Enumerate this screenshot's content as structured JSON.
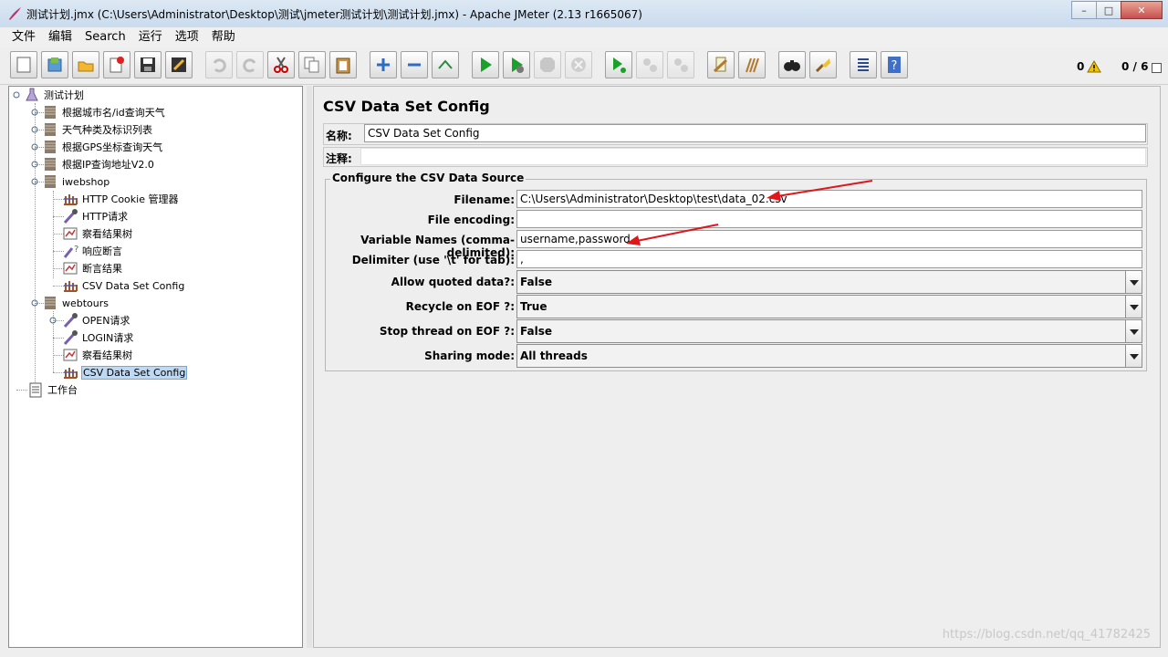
{
  "window": {
    "title": "测试计划.jmx (C:\\Users\\Administrator\\Desktop\\测试\\jmeter测试计划\\测试计划.jmx) - Apache JMeter (2.13 r1665067)",
    "minimize": "–",
    "maximize": "□",
    "close": "✕"
  },
  "menu": [
    "文件",
    "编辑",
    "Search",
    "运行",
    "选项",
    "帮助"
  ],
  "toolbar": {
    "error_count": "0",
    "thread_count": "0 / 6"
  },
  "tree": {
    "root": "测试计划",
    "items": [
      "根据城市名/id查询天气",
      "天气种类及标识列表",
      "根据GPS坐标查询天气",
      "根据IP查询地址V2.0",
      "iwebshop",
      "HTTP Cookie 管理器",
      "HTTP请求",
      "察看结果树",
      "响应断言",
      "断言结果",
      "CSV Data Set Config",
      "webtours",
      "OPEN请求",
      "LOGIN请求",
      "察看结果树",
      "CSV Data Set Config",
      "工作台"
    ]
  },
  "panel": {
    "title": "CSV Data Set Config",
    "name_label": "名称:",
    "name_value": "CSV Data Set Config",
    "comment_label": "注释:",
    "comment_value": "",
    "group_title": "Configure the CSV Data Source",
    "fields": {
      "filename_label": "Filename:",
      "filename_value": "C:\\Users\\Administrator\\Desktop\\test\\data_02.csv",
      "encoding_label": "File encoding:",
      "encoding_value": "",
      "varnames_label": "Variable Names (comma-delimited):",
      "varnames_value": "username,password",
      "delimiter_label": "Delimiter (use '\\t' for tab):",
      "delimiter_value": ",",
      "quoted_label": "Allow quoted data?:",
      "quoted_value": "False",
      "recycle_label": "Recycle on EOF ?:",
      "recycle_value": "True",
      "stop_label": "Stop thread on EOF ?:",
      "stop_value": "False",
      "sharing_label": "Sharing mode:",
      "sharing_value": "All threads"
    }
  },
  "watermark": "https://blog.csdn.net/qq_41782425",
  "colors": {
    "selection": "#bfd9f3",
    "arrow_annotation": "#e0161b",
    "run_green": "#1aa02b"
  }
}
